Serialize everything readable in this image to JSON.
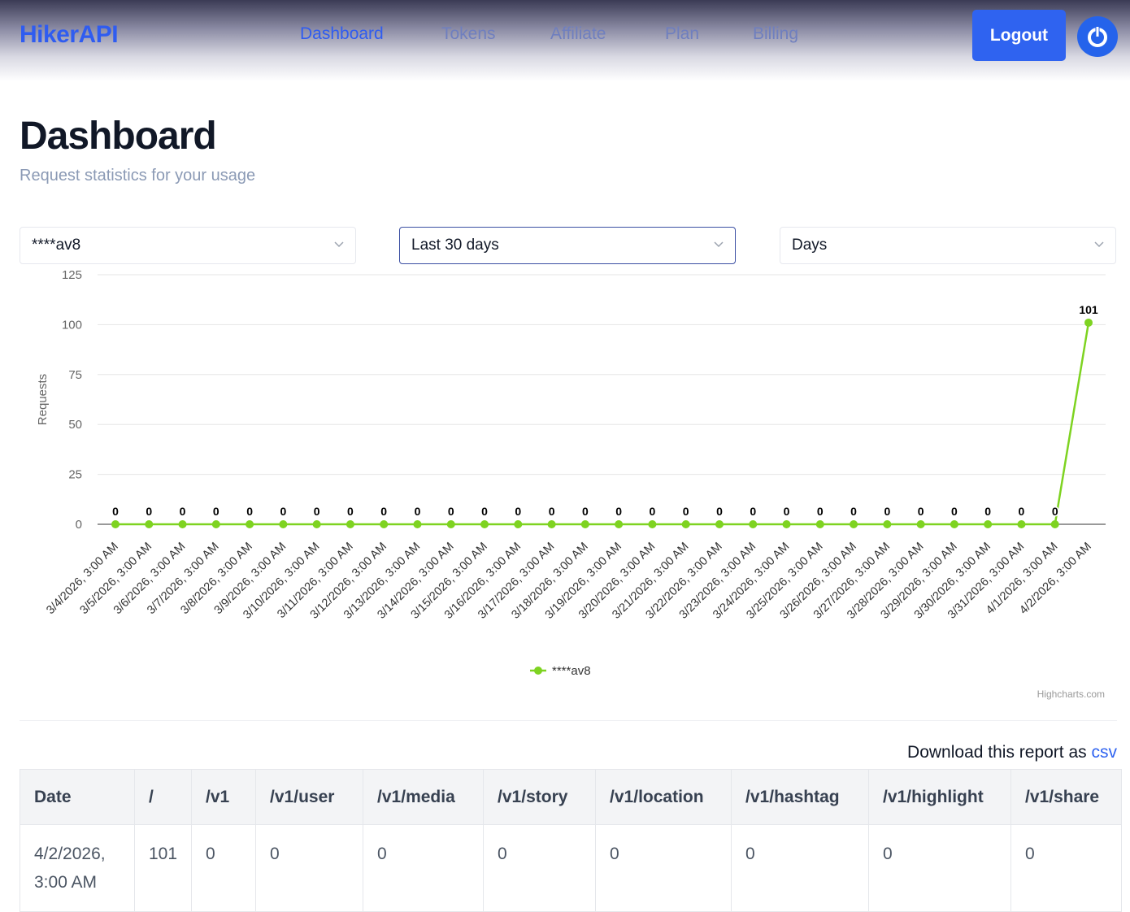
{
  "brand": "HikerAPI",
  "nav": [
    {
      "label": "Dashboard",
      "active": true
    },
    {
      "label": "Tokens",
      "active": false
    },
    {
      "label": "Affiliate",
      "active": false
    },
    {
      "label": "Plan",
      "active": false
    },
    {
      "label": "Billing",
      "active": false
    }
  ],
  "header": {
    "logout_label": "Logout",
    "avatar_icon": "power-icon"
  },
  "page": {
    "title": "Dashboard",
    "subtitle": "Request statistics for your usage"
  },
  "filters": {
    "token": "****av8",
    "period": "Last 30 days",
    "granularity": "Days"
  },
  "chart_data": {
    "type": "line",
    "ylabel": "Requests",
    "ylim": [
      0,
      125
    ],
    "yticks": [
      0,
      25,
      50,
      75,
      100,
      125
    ],
    "categories": [
      "3/4/2026, 3:00 AM",
      "3/5/2026, 3:00 AM",
      "3/6/2026, 3:00 AM",
      "3/7/2026, 3:00 AM",
      "3/8/2026, 3:00 AM",
      "3/9/2026, 3:00 AM",
      "3/10/2026, 3:00 AM",
      "3/11/2026, 3:00 AM",
      "3/12/2026, 3:00 AM",
      "3/13/2026, 3:00 AM",
      "3/14/2026, 3:00 AM",
      "3/15/2026, 3:00 AM",
      "3/16/2026, 3:00 AM",
      "3/17/2026, 3:00 AM",
      "3/18/2026, 3:00 AM",
      "3/19/2026, 3:00 AM",
      "3/20/2026, 3:00 AM",
      "3/21/2026, 3:00 AM",
      "3/22/2026, 3:00 AM",
      "3/23/2026, 3:00 AM",
      "3/24/2026, 3:00 AM",
      "3/25/2026, 3:00 AM",
      "3/26/2026, 3:00 AM",
      "3/27/2026, 3:00 AM",
      "3/28/2026, 3:00 AM",
      "3/29/2026, 3:00 AM",
      "3/30/2026, 3:00 AM",
      "3/31/2026, 3:00 AM",
      "4/1/2026, 3:00 AM",
      "4/2/2026, 3:00 AM"
    ],
    "series": [
      {
        "name": "****av8",
        "color": "#7ed321",
        "values": [
          0,
          0,
          0,
          0,
          0,
          0,
          0,
          0,
          0,
          0,
          0,
          0,
          0,
          0,
          0,
          0,
          0,
          0,
          0,
          0,
          0,
          0,
          0,
          0,
          0,
          0,
          0,
          0,
          0,
          101
        ]
      }
    ],
    "legend": "bottom-center",
    "grid": true,
    "credits": "Highcharts.com"
  },
  "report": {
    "download_text": "Download this report as",
    "download_link": "csv"
  },
  "table": {
    "columns": [
      "Date",
      "/",
      "/v1",
      "/v1/user",
      "/v1/media",
      "/v1/story",
      "/v1/location",
      "/v1/hashtag",
      "/v1/highlight",
      "/v1/share"
    ],
    "rows": [
      {
        "date_line1": "4/2/2026,",
        "date_line2": "3:00 AM",
        "values": [
          "101",
          "0",
          "0",
          "0",
          "0",
          "0",
          "0",
          "0",
          "0"
        ]
      }
    ]
  }
}
